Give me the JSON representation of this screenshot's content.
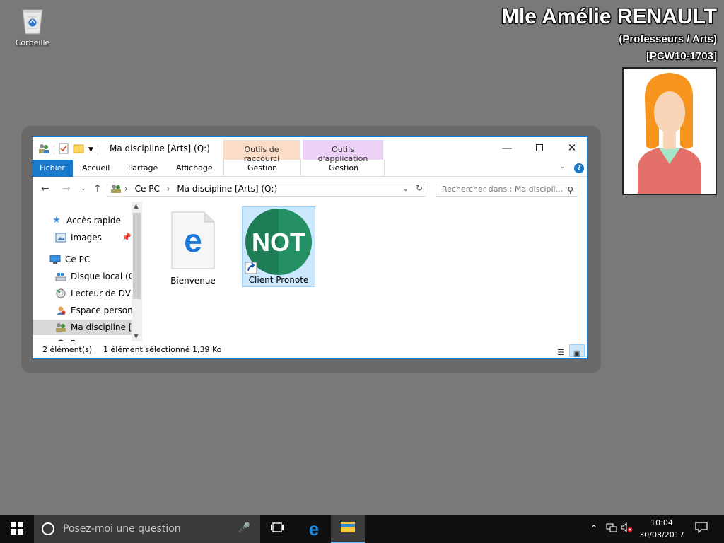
{
  "desktop": {
    "recycle_bin_label": "Corbeille"
  },
  "user": {
    "name": "Mle Amélie RENAULT",
    "role": "(Professeurs / Arts)",
    "machine": "[PCW10-1703]"
  },
  "explorer": {
    "title": "Ma discipline [Arts] (Q:)",
    "context_tab_shortcut": "Outils de raccourci",
    "context_tab_app": "Outils d'application",
    "ribbon_tabs": [
      "Fichier",
      "Accueil",
      "Partage",
      "Affichage"
    ],
    "gestion_label_1": "Gestion",
    "gestion_label_2": "Gestion",
    "address": {
      "segments": [
        "Ce PC",
        "Ma discipline [Arts] (Q:)"
      ]
    },
    "search_placeholder": "Rechercher dans : Ma discipli...",
    "nav": {
      "quick_access": "Accès rapide",
      "images": "Images",
      "this_pc": "Ce PC",
      "local_disk": "Disque local (C:)",
      "dvd": "Lecteur de DVD (",
      "personal_space": "Espace personne",
      "discipline": "Ma discipline [A",
      "partial": "P"
    },
    "files": [
      {
        "name": "Bienvenue",
        "icon": "edge-html-icon",
        "selected": false
      },
      {
        "name": "Client Pronote",
        "icon": "pronote-shortcut-icon",
        "selected": true
      }
    ],
    "status": {
      "count": "2 élément(s)",
      "selection": "1 élément sélectionné  1,39 Ko"
    }
  },
  "taskbar": {
    "search_placeholder": "Posez-moi une question",
    "time": "10:04",
    "date": "30/08/2017"
  },
  "colors": {
    "desktop_bg": "#7a7879",
    "accent": "#1979ca",
    "pronote_green": "#1e7d55",
    "edge_blue": "#1b7ad9"
  }
}
